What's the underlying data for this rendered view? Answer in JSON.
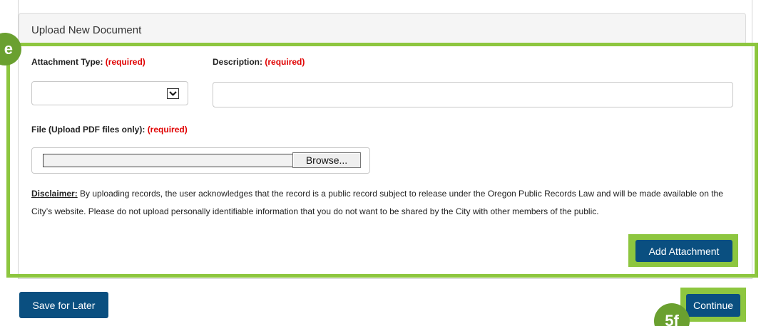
{
  "panel": {
    "title": "Upload New Document"
  },
  "annotations": {
    "section_marker": "e",
    "continue_marker": "5f"
  },
  "form": {
    "attachment_type_label": "Attachment Type:",
    "description_label": "Description:",
    "file_label": "File (Upload PDF files only):",
    "required_text": "(required)",
    "attachment_type_value": "",
    "description_value": "",
    "browse_label": "Browse..."
  },
  "disclaimer": {
    "heading": "Disclaimer:",
    "text": " By uploading records, the user acknowledges that the record is a public record subject to release under the Oregon Public Records Law and will be made available on the City’s website. Please do not upload personally identifiable information that you do not want to be shared by the City with other members of the public."
  },
  "buttons": {
    "add_attachment": "Add Attachment",
    "save_for_later": "Save for Later",
    "continue": "Continue"
  },
  "colors": {
    "primary_button": "#0a4f80",
    "highlight": "#8dc63f",
    "required": "#e00000"
  }
}
